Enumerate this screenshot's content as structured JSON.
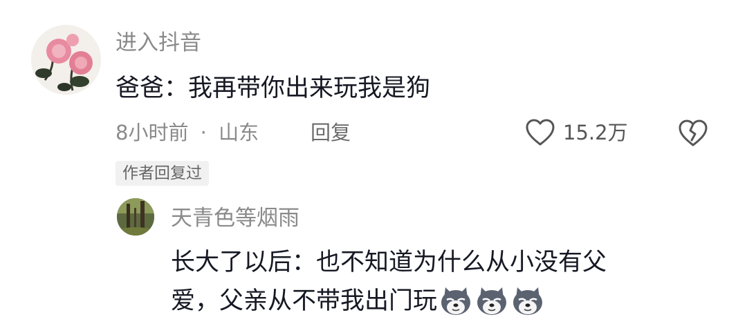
{
  "comment": {
    "username": "进入抖音",
    "text": "爸爸：我再带你出来玩我是狗",
    "time": "8小时前",
    "separator": "·",
    "location": "山东",
    "reply_label": "回复",
    "like_count": "15.2万",
    "author_badge": "作者回复过"
  },
  "reply": {
    "username": "天青色等烟雨",
    "text_line1": "长大了以后：也不知道为什么从小没有父",
    "text_line2": "爱，父亲从不带我出门玩",
    "emojis": [
      "dog-emoji",
      "dog-emoji",
      "dog-emoji"
    ]
  },
  "icons": {
    "like": "heart-outline-icon",
    "dislike": "broken-heart-icon"
  }
}
